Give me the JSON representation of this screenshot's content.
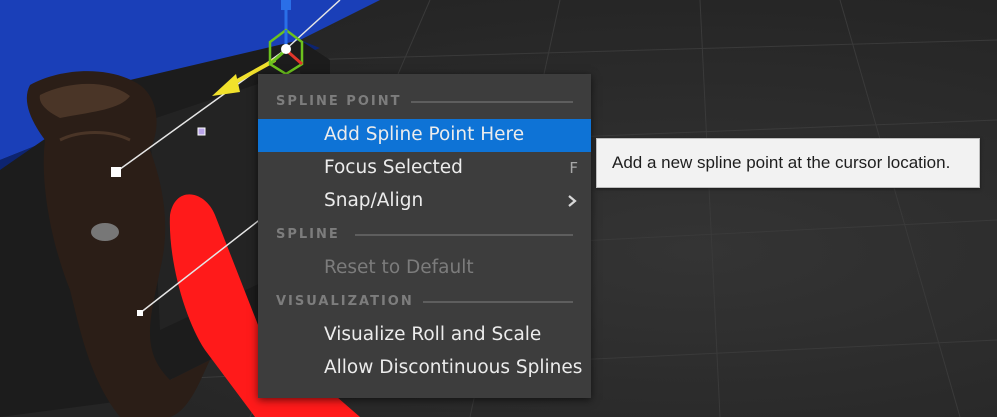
{
  "context_menu": {
    "sections": [
      {
        "heading": "SPLINE POINT",
        "items": [
          {
            "label": "Add Spline Point Here",
            "selected": true
          },
          {
            "label": "Focus Selected",
            "shortcut": "F"
          },
          {
            "label": "Snap/Align",
            "submenu_icon": "chevron-right-icon"
          }
        ]
      },
      {
        "heading": "SPLINE",
        "items": [
          {
            "label": "Reset to Default",
            "disabled": true
          }
        ]
      },
      {
        "heading": "VISUALIZATION",
        "items": [
          {
            "label": "Visualize Roll and Scale"
          },
          {
            "label": "Allow Discontinuous Splines"
          }
        ]
      }
    ]
  },
  "tooltip": {
    "text": "Add a new spline point at the cursor location."
  },
  "colors": {
    "menu_background": "#3d3d3d",
    "selection": "#0e73d6",
    "section_heading": "#7d7d7d",
    "tooltip_background": "#f2f2f2",
    "viewport_floor": "#2a2a2a",
    "gizmo_x": "#e0352b",
    "gizmo_y": "#6cc21e",
    "gizmo_z": "#2a6fe8",
    "tangent_arrow": "#f1e12c",
    "red_object": "#ff1a1a",
    "blue_wall": "#1a3fb8"
  }
}
